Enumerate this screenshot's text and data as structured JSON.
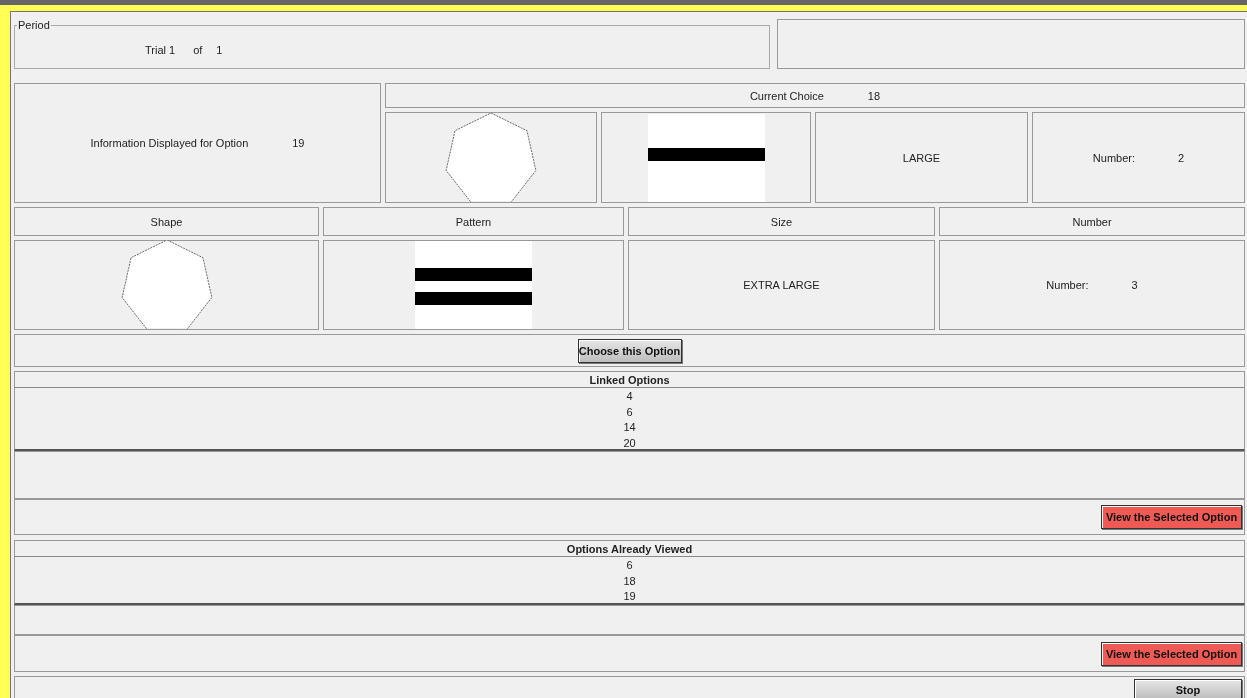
{
  "period": {
    "legend": "Period",
    "trial_label": "Trial 1",
    "of_label": "of",
    "total": "1"
  },
  "info": {
    "label": "Information Displayed for Option",
    "option": "19"
  },
  "current_choice": {
    "label": "Current Choice",
    "option": "18",
    "shape": {
      "kind": "heptagon"
    },
    "pattern": {
      "kind": "one-stripe"
    },
    "size": "LARGE",
    "number_label": "Number:",
    "number": "2"
  },
  "attribute_headers": [
    "Shape",
    "Pattern",
    "Size",
    "Number"
  ],
  "option": {
    "shape": {
      "kind": "heptagon"
    },
    "pattern": {
      "kind": "two-stripes"
    },
    "size": "EXTRA LARGE",
    "number_label": "Number:",
    "number": "3"
  },
  "choose_button": "Choose this Option",
  "linked_options": {
    "title": "Linked Options",
    "items": [
      "4",
      "6",
      "14",
      "20"
    ],
    "button": "View the Selected Option"
  },
  "viewed_options": {
    "title": "Options Already Viewed",
    "items": [
      "6",
      "18",
      "19"
    ],
    "button": "View the Selected Option"
  },
  "stop_button": "Stop"
}
